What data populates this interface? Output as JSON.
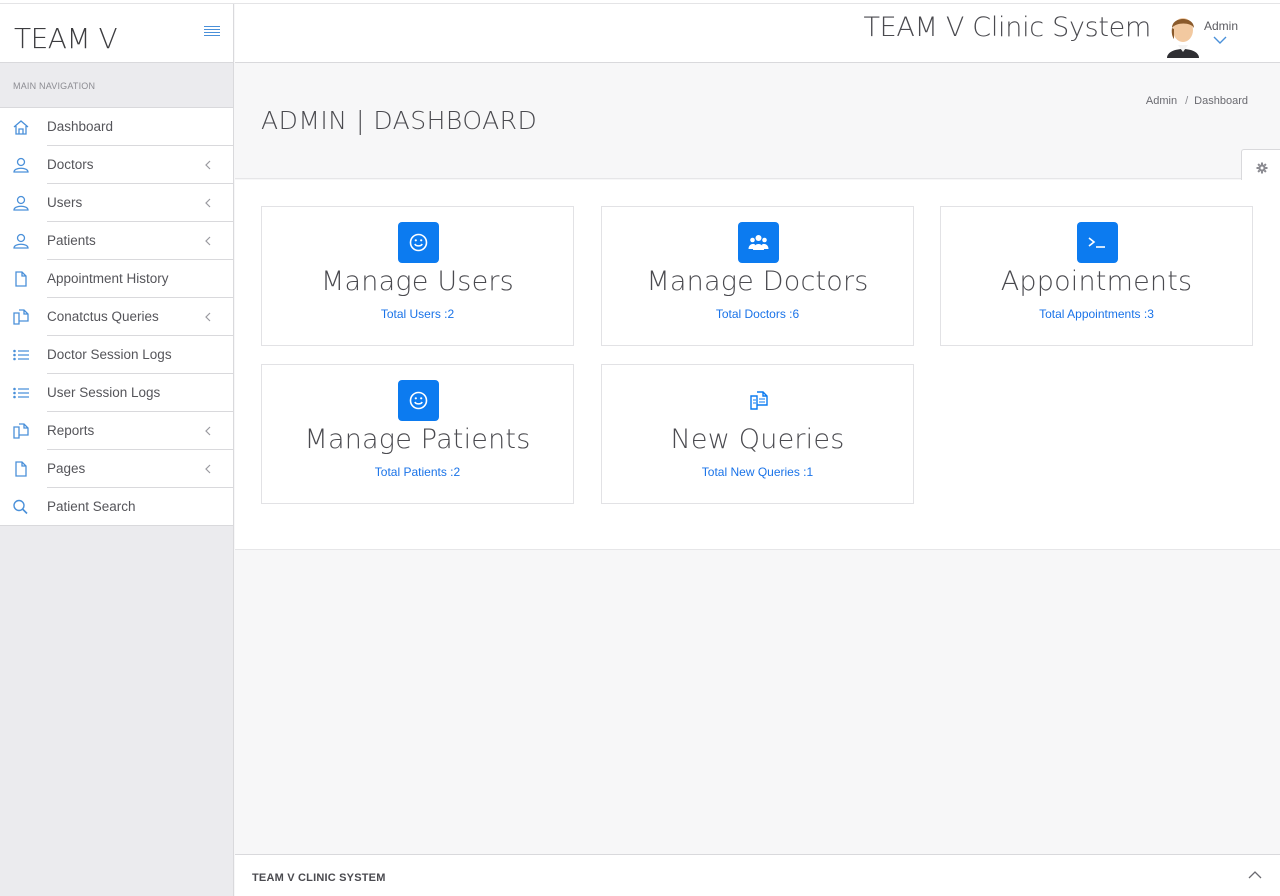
{
  "brand": {
    "name": "TEAM V"
  },
  "header": {
    "app_title": "TEAM V Clinic System",
    "user_name": "Admin"
  },
  "sidebar": {
    "heading": "MAIN NAVIGATION",
    "items": [
      {
        "label": "Dashboard",
        "icon": "home-icon",
        "has_submenu": false
      },
      {
        "label": "Doctors",
        "icon": "user-icon",
        "has_submenu": true
      },
      {
        "label": "Users",
        "icon": "user-icon",
        "has_submenu": true
      },
      {
        "label": "Patients",
        "icon": "user-icon",
        "has_submenu": true
      },
      {
        "label": "Appointment History",
        "icon": "file-icon",
        "has_submenu": false
      },
      {
        "label": "Conatctus Queries",
        "icon": "files-icon",
        "has_submenu": true
      },
      {
        "label": "Doctor Session Logs",
        "icon": "list-icon",
        "has_submenu": false
      },
      {
        "label": "User Session Logs",
        "icon": "list-icon",
        "has_submenu": false
      },
      {
        "label": "Reports",
        "icon": "files-icon",
        "has_submenu": true
      },
      {
        "label": "Pages",
        "icon": "file-icon",
        "has_submenu": true
      },
      {
        "label": "Patient Search",
        "icon": "search-icon",
        "has_submenu": false
      }
    ]
  },
  "page": {
    "title": "ADMIN | DASHBOARD",
    "breadcrumb": [
      "Admin",
      "Dashboard"
    ]
  },
  "cards": [
    {
      "title": "Manage Users",
      "subtitle": "Total Users :2",
      "icon": "smile-icon"
    },
    {
      "title": "Manage Doctors",
      "subtitle": "Total Doctors :6",
      "icon": "users-group-icon"
    },
    {
      "title": "Appointments",
      "subtitle": "Total Appointments :3",
      "icon": "terminal-icon"
    },
    {
      "title": "Manage Patients",
      "subtitle": "Total Patients :2",
      "icon": "smile-icon"
    },
    {
      "title": "New Queries",
      "subtitle": "Total New Queries :1",
      "icon": "files-icon"
    }
  ],
  "footer": {
    "text": "TEAM V CLINIC SYSTEM"
  },
  "colors": {
    "accent": "#0c7bf0",
    "link": "#1a73e8",
    "icon": "#4a90d9"
  }
}
